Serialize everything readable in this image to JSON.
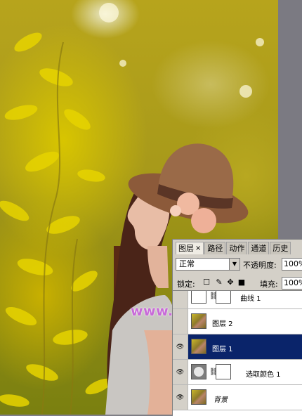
{
  "watermark": "www.68ps.com",
  "layers_panel": {
    "tabs": [
      {
        "label": "图层",
        "active": true,
        "close": "×"
      },
      {
        "label": "路径",
        "active": false
      },
      {
        "label": "动作",
        "active": false
      },
      {
        "label": "通道",
        "active": false
      },
      {
        "label": "历史",
        "active": false
      }
    ],
    "blend_mode": "正常",
    "opacity_label": "不透明度:",
    "opacity_value": "100%",
    "lock_label": "锁定:",
    "fill_label": "填充:",
    "fill_value": "100%",
    "layers": [
      {
        "name": "曲线 1",
        "visible": false,
        "selected": false,
        "thumb": "curve-adjustment",
        "has_mask": true
      },
      {
        "name": "图层 2",
        "visible": false,
        "selected": false,
        "thumb": "photo",
        "has_mask": false
      },
      {
        "name": "图层 1",
        "visible": true,
        "selected": true,
        "thumb": "photo",
        "has_mask": false
      },
      {
        "name": "选取颜色 1",
        "visible": true,
        "selected": false,
        "thumb": "selective-color-adjustment",
        "has_mask": true
      },
      {
        "name": "背景",
        "visible": true,
        "selected": false,
        "thumb": "photo",
        "has_mask": false
      }
    ]
  },
  "colors": {
    "selection": "#0a246a",
    "panel_bg": "#d4d0c8",
    "watermark": "#c86ad8"
  }
}
